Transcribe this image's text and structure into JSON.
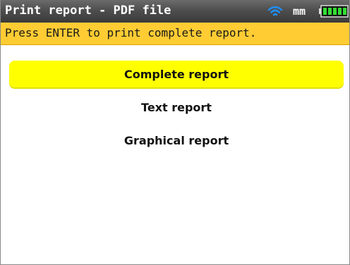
{
  "header": {
    "title": "Print report - PDF file",
    "unit": "mm",
    "wifi_icon": "wifi-icon",
    "battery_icon": "battery-icon",
    "battery_color": "#33dd33"
  },
  "hint": {
    "text": "Press ENTER to print complete report.",
    "background": "#ffcc33"
  },
  "menu": {
    "selected_color": "#ffff00",
    "items": [
      {
        "label": "Complete report",
        "selected": true
      },
      {
        "label": "Text report",
        "selected": false
      },
      {
        "label": "Graphical report",
        "selected": false
      }
    ]
  }
}
